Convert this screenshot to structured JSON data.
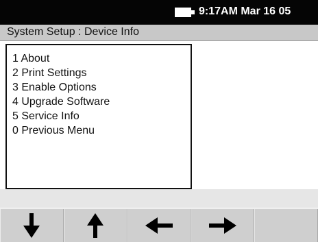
{
  "status_bar": {
    "datetime": "9:17AM Mar 16 05",
    "battery_icon": "battery-icon"
  },
  "titlebar": {
    "title": "System Setup : Device Info"
  },
  "menu": {
    "items": [
      {
        "label": "1 About"
      },
      {
        "label": "2 Print Settings"
      },
      {
        "label": "3 Enable Options"
      },
      {
        "label": "4 Upgrade Software"
      },
      {
        "label": "5 Service Info"
      },
      {
        "label": "0 Previous Menu"
      }
    ]
  },
  "softkeys": [
    {
      "icon": "arrow-down-icon"
    },
    {
      "icon": "arrow-up-icon"
    },
    {
      "icon": "arrow-left-icon"
    },
    {
      "icon": "arrow-right-icon"
    },
    {
      "icon": ""
    }
  ],
  "colors": {
    "status_bar_bg": "#050505",
    "title_bar_bg": "#c8c8c8",
    "softkey_bg": "#cfcfcf",
    "panel_border": "#111111"
  }
}
